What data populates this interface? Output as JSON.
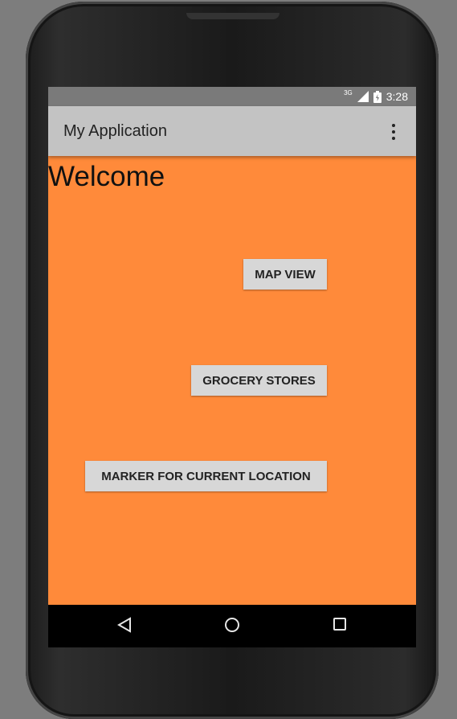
{
  "status_bar": {
    "network": "3G",
    "time": "3:28",
    "icons": [
      "signal-icon",
      "battery-icon"
    ]
  },
  "app_bar": {
    "title": "My Application",
    "menu_icon": "overflow-menu-icon"
  },
  "main": {
    "heading": "Welcome",
    "background_color": "#ff8a3a",
    "buttons": [
      {
        "label": "MAP VIEW"
      },
      {
        "label": "GROCERY STORES"
      },
      {
        "label": "MARKER FOR CURRENT LOCATION"
      }
    ]
  },
  "nav_bar": {
    "icons": [
      "back-icon",
      "home-icon",
      "recents-icon"
    ]
  }
}
